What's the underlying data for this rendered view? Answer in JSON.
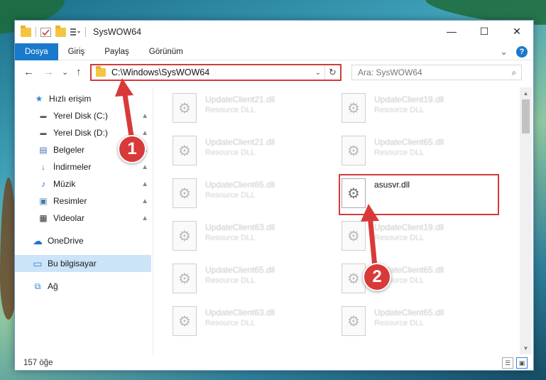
{
  "window": {
    "title": "SysWOW64",
    "controls": {
      "minimize": "—",
      "maximize": "☐",
      "close": "✕"
    }
  },
  "ribbon": {
    "tabs": [
      {
        "label": "Dosya",
        "active": true
      },
      {
        "label": "Giriş"
      },
      {
        "label": "Paylaş"
      },
      {
        "label": "Görünüm"
      }
    ],
    "collapse": "⌄",
    "help": "?"
  },
  "address": {
    "path": "C:\\Windows\\SysWOW64",
    "back": "←",
    "forward": "→",
    "recent": "⌄",
    "up": "↑",
    "dropdown": "⌄",
    "refresh": "↻"
  },
  "search": {
    "placeholder": "Ara: SysWOW64",
    "icon": "⌕"
  },
  "nav": {
    "items": [
      {
        "label": "Hızlı erişim",
        "icon": "★",
        "color": "#3a86d6"
      },
      {
        "label": "Yerel Disk (C:)",
        "icon": "▬",
        "color": "#555555",
        "pinned": true
      },
      {
        "label": "Yerel Disk (D:)",
        "icon": "▬",
        "color": "#555555",
        "pinned": true
      },
      {
        "label": "Belgeler",
        "icon": "▤",
        "color": "#4a78b0",
        "pinned": true
      },
      {
        "label": "İndirmeler",
        "icon": "↓",
        "color": "#2f72c4",
        "pinned": true
      },
      {
        "label": "Müzik",
        "icon": "♪",
        "color": "#2f72c4",
        "pinned": true
      },
      {
        "label": "Resimler",
        "icon": "▣",
        "color": "#4a78b0",
        "pinned": true
      },
      {
        "label": "Videolar",
        "icon": "▦",
        "color": "#333333",
        "pinned": true
      },
      {
        "label": "OneDrive",
        "icon": "☁",
        "color": "#1f6fc9"
      },
      {
        "label": "Bu bilgisayar",
        "icon": "▭",
        "color": "#2a7fd4",
        "selected": true
      },
      {
        "label": "Ağ",
        "icon": "⧉",
        "color": "#2a7fd4"
      }
    ],
    "pin_icon": "📌"
  },
  "files": [
    {
      "name": "UpdateClient21.dll",
      "type": "Resource DLL"
    },
    {
      "name": "UpdateClient19.dll",
      "type": "Resource DLL"
    },
    {
      "name": "UpdateClient21.dll",
      "type": "Resource DLL"
    },
    {
      "name": "UpdateClient65.dll",
      "type": "Resource DLL"
    },
    {
      "name": "UpdateClient65.dll",
      "type": "Resource DLL"
    },
    {
      "name": "asusvr.dll",
      "type": ""
    },
    {
      "name": "UpdateClient63.dll",
      "type": "Resource DLL"
    },
    {
      "name": "UpdateClient19.dll",
      "type": "Resource DLL"
    },
    {
      "name": "UpdateClient65.dll",
      "type": "Resource DLL"
    },
    {
      "name": "UpdateClient65.dll",
      "type": "Resource DLL"
    },
    {
      "name": "UpdateClient63.dll",
      "type": "Resource DLL"
    },
    {
      "name": "UpdateClient65.dll",
      "type": "Resource DLL"
    }
  ],
  "status": {
    "count": "157 öğe"
  },
  "annotations": {
    "step1": "1",
    "step2": "2",
    "color": "#d83a3a"
  }
}
